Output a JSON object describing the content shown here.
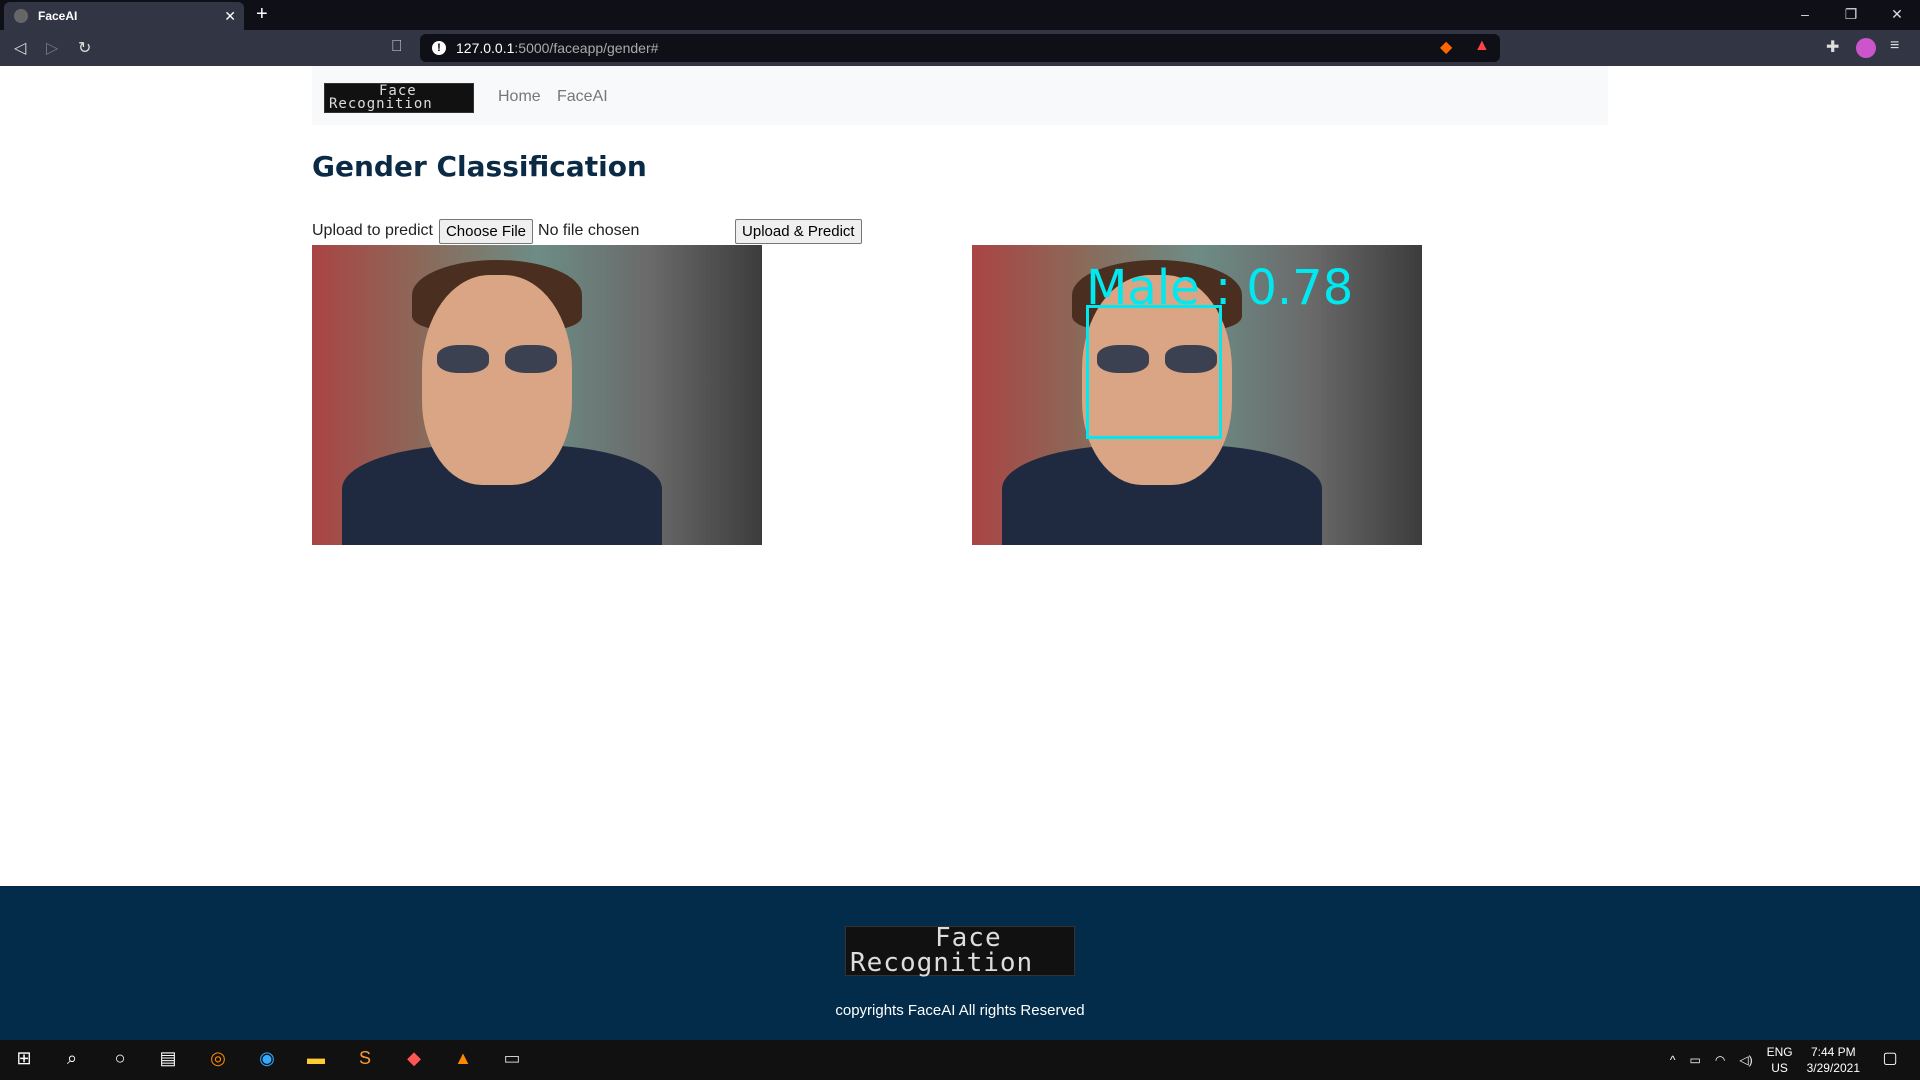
{
  "browser": {
    "tab_title": "FaceAI",
    "url_host": "127.0.0.1",
    "url_rest": ":5000/faceapp/gender#"
  },
  "navbar": {
    "logo_line1": "Face",
    "logo_line2": "Recognition",
    "links": [
      "Home",
      "FaceAI"
    ]
  },
  "page": {
    "title": "Gender Classification",
    "upload_label": "Upload to predict",
    "choose_file": "Choose File",
    "no_file": "No file chosen",
    "submit": "Upload & Predict"
  },
  "prediction": {
    "label": "Male : 0.78",
    "box_color": "#00e8f0"
  },
  "footer": {
    "logo_line1": "Face",
    "logo_line2": "Recognition",
    "copyright": "copyrights FaceAI All rights Reserved",
    "bg": "#022c4a"
  },
  "taskbar": {
    "lang1": "ENG",
    "lang2": "US",
    "time": "7:44 PM",
    "date": "3/29/2021"
  }
}
